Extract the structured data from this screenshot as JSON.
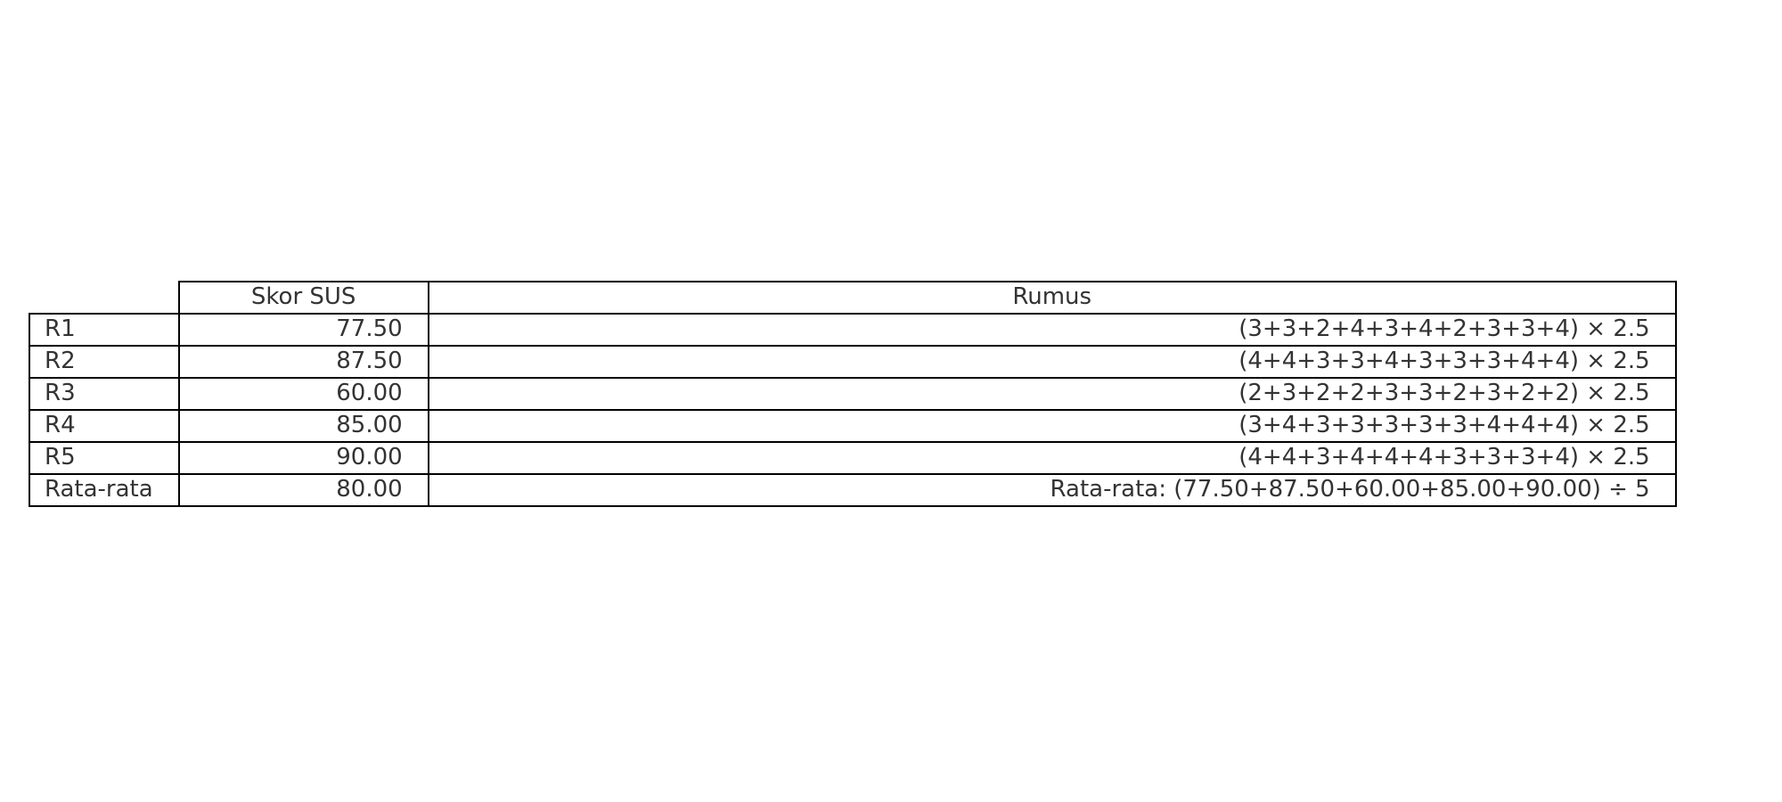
{
  "chart_data": {
    "type": "table",
    "columns": [
      "",
      "Skor SUS",
      "Rumus"
    ],
    "rows": [
      {
        "label": "R1",
        "score": "77.50",
        "formula": "(3+3+2+4+3+4+2+3+3+4) × 2.5"
      },
      {
        "label": "R2",
        "score": "87.50",
        "formula": "(4+4+3+3+4+3+3+3+4+4) × 2.5"
      },
      {
        "label": "R3",
        "score": "60.00",
        "formula": "(2+3+2+2+3+3+2+3+2+2) × 2.5"
      },
      {
        "label": "R4",
        "score": "85.00",
        "formula": "(3+4+3+3+3+3+3+4+4+4) × 2.5"
      },
      {
        "label": "R5",
        "score": "90.00",
        "formula": "(4+4+3+4+4+4+3+3+3+4) × 2.5"
      },
      {
        "label": "Rata-rata",
        "score": "80.00",
        "formula": "Rata-rata: (77.50+87.50+60.00+85.00+90.00) ÷ 5"
      }
    ]
  }
}
